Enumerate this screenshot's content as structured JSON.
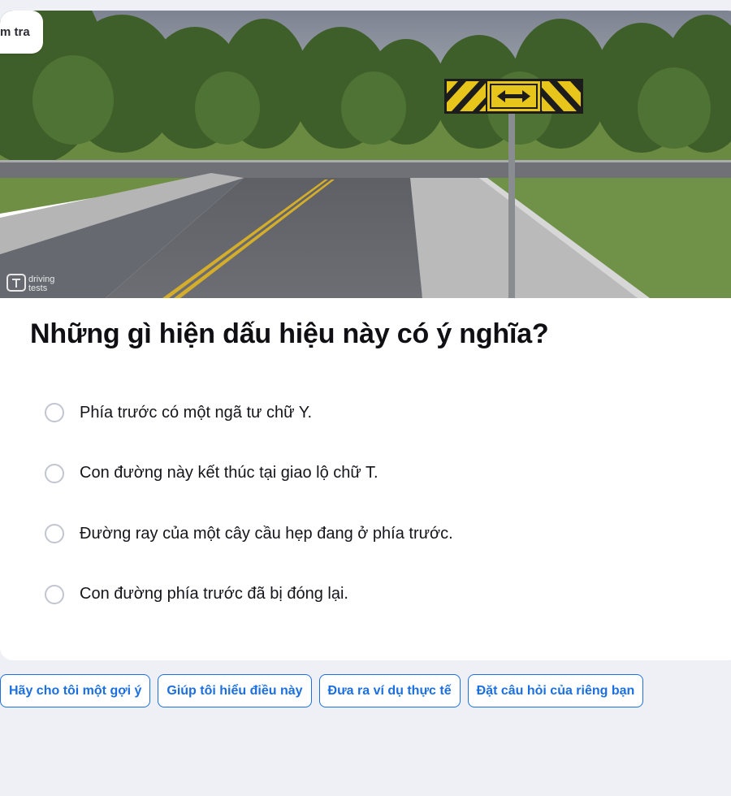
{
  "breadcrumb_tag": "m tra",
  "image": {
    "watermark_line1": "driving",
    "watermark_line2": "tests"
  },
  "question": "Những gì hiện dấu hiệu này có ý nghĩa?",
  "options": [
    {
      "label": "Phía trước có một ngã tư chữ Y."
    },
    {
      "label": "Con đường này kết thúc tại giao lộ chữ T."
    },
    {
      "label": "Đường ray của một cây cầu hẹp đang ở phía trước."
    },
    {
      "label": "Con đường phía trước đã bị đóng lại."
    }
  ],
  "suggestions": [
    {
      "label": "Hãy cho tôi một gợi ý"
    },
    {
      "label": "Giúp tôi hiểu điều này"
    },
    {
      "label": "Đưa ra ví dụ thực tế"
    },
    {
      "label": "Đặt câu hỏi của riêng bạn"
    }
  ],
  "colors": {
    "accent": "#1b6fe0",
    "background": "#eff0f6",
    "sign_yellow": "#e8c51a"
  }
}
